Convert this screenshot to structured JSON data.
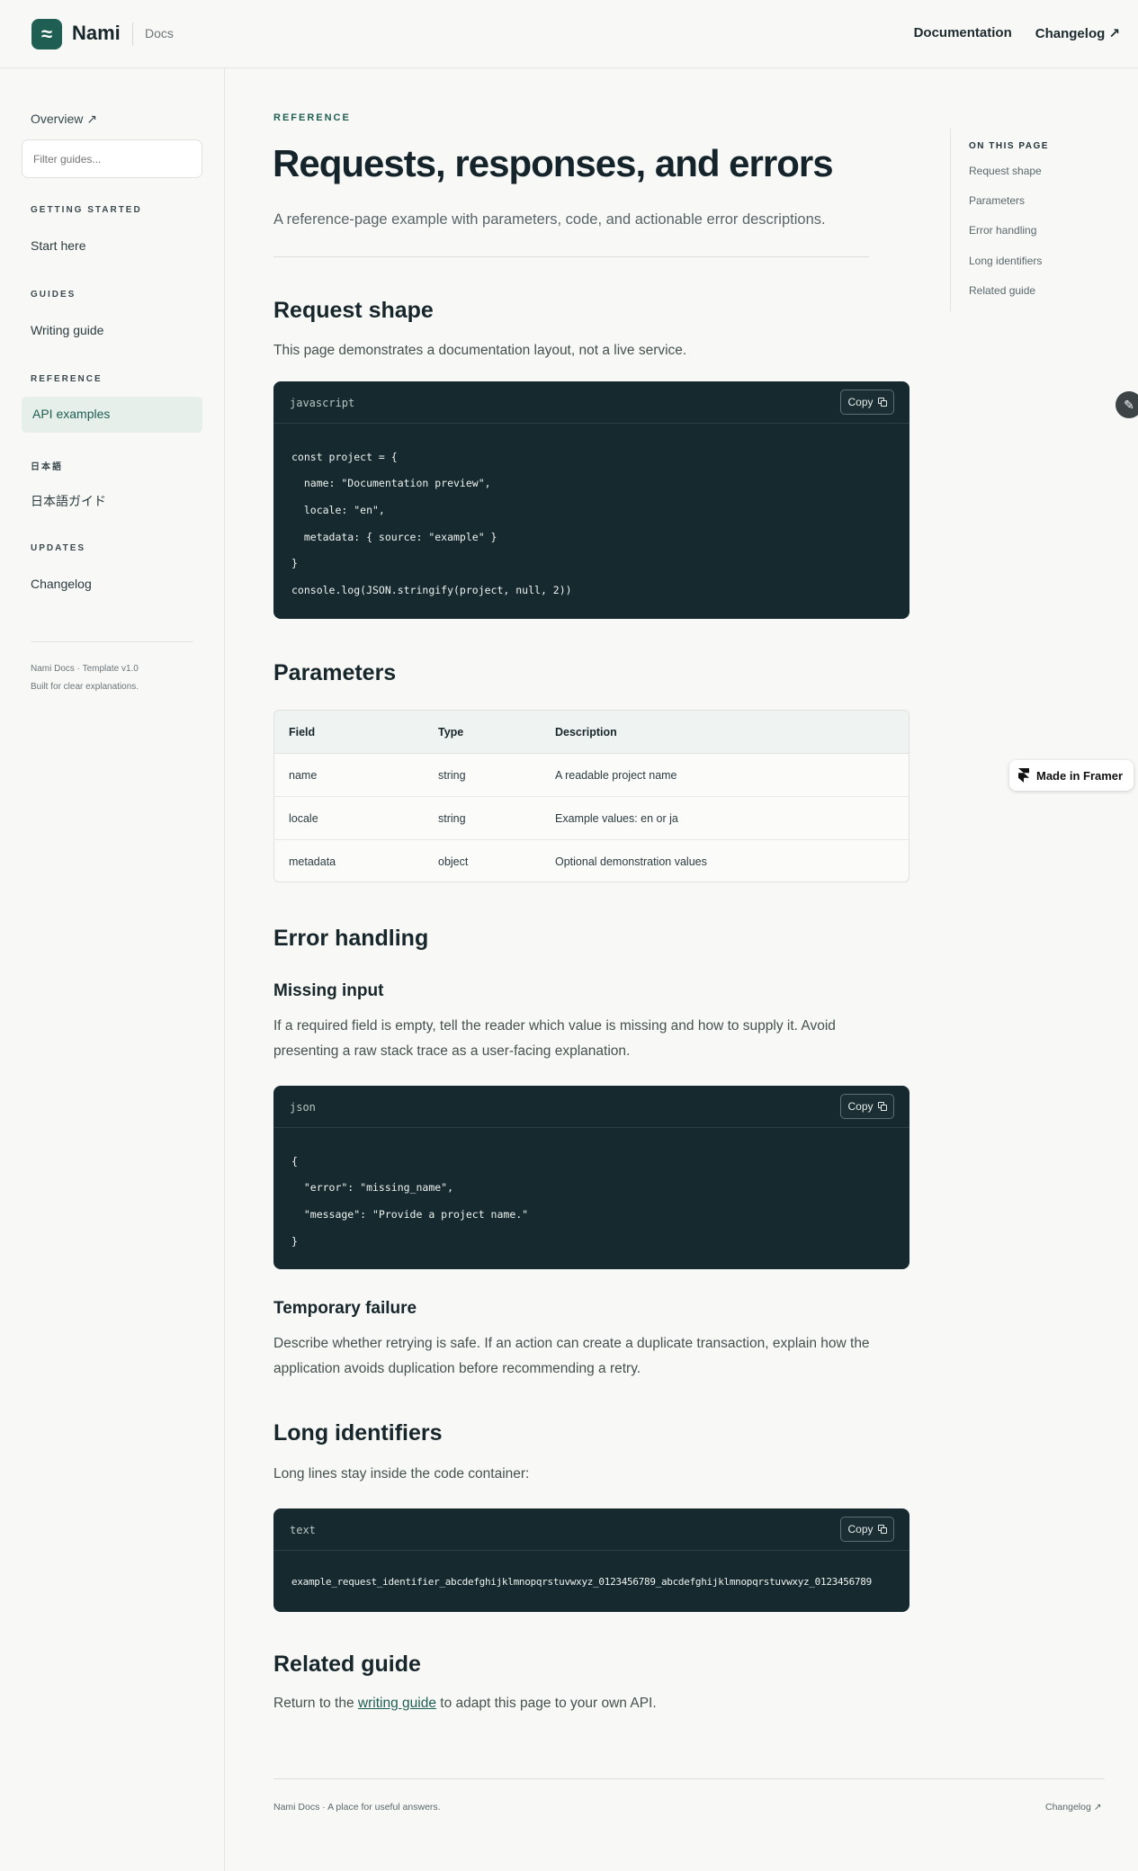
{
  "header": {
    "brand": "Nami",
    "brand_sub": "Docs",
    "nav": [
      "Documentation",
      "Changelog ↗"
    ]
  },
  "sidebar": {
    "overview": "Overview ↗",
    "filter_placeholder": "Filter guides...",
    "sections": [
      {
        "heading": "GETTING STARTED",
        "items": [
          "Start here"
        ]
      },
      {
        "heading": "GUIDES",
        "items": [
          "Writing guide"
        ]
      },
      {
        "heading": "REFERENCE",
        "items": [
          "API examples"
        ]
      },
      {
        "heading": "日本語",
        "items": [
          "日本語ガイド"
        ]
      },
      {
        "heading": "UPDATES",
        "items": [
          "Changelog"
        ]
      }
    ],
    "active_item": "API examples",
    "footer": [
      "Nami Docs · Template v1.0",
      "Built for clear explanations."
    ]
  },
  "main": {
    "eyebrow": "REFERENCE",
    "title": "Requests, responses, and errors",
    "lead": "A reference-page example with parameters, code, and actionable error descriptions.",
    "request_shape": {
      "heading": "Request shape",
      "text": "This page demonstrates a documentation layout, not a live service.",
      "code": {
        "lang": "javascript",
        "copy": "Copy",
        "lines": [
          "const project = {",
          "  name: \"Documentation preview\",",
          "  locale: \"en\",",
          "  metadata: { source: \"example\" }",
          "}",
          "console.log(JSON.stringify(project, null, 2))"
        ]
      }
    },
    "parameters": {
      "heading": "Parameters",
      "columns": [
        "Field",
        "Type",
        "Description"
      ],
      "rows": [
        [
          "name",
          "string",
          "A readable project name"
        ],
        [
          "locale",
          "string",
          "Example values: en or ja"
        ],
        [
          "metadata",
          "object",
          "Optional demonstration values"
        ]
      ]
    },
    "error_handling": {
      "heading": "Error handling",
      "missing_input": {
        "heading": "Missing input",
        "text": "If a required field is empty, tell the reader which value is missing and how to supply it. Avoid presenting a raw stack trace as a user-facing explanation.",
        "code": {
          "lang": "json",
          "copy": "Copy",
          "lines": [
            "{",
            "  \"error\": \"missing_name\",",
            "  \"message\": \"Provide a project name.\"",
            "}"
          ]
        }
      },
      "temporary_failure": {
        "heading": "Temporary failure",
        "text": "Describe whether retrying is safe. If an action can create a duplicate transaction, explain how the application avoids duplication before recommending a retry."
      }
    },
    "long_identifiers": {
      "heading": "Long identifiers",
      "text": "Long lines stay inside the code container:",
      "code": {
        "lang": "text",
        "copy": "Copy",
        "lines": [
          "example_request_identifier_abcdefghijklmnopqrstuvwxyz_0123456789_abcdefghijklmnopqrstuvwxyz_0123456789"
        ]
      }
    },
    "related_guide": {
      "heading": "Related guide",
      "before": "Return to the ",
      "link": "writing guide",
      "after": " to adapt this page to your own API."
    }
  },
  "toc": {
    "heading": "ON THIS PAGE",
    "items": [
      "Request shape",
      "Parameters",
      "Error handling",
      "Long identifiers",
      "Related guide"
    ]
  },
  "framer_badge": "Made in Framer",
  "footer": {
    "left": "Nami Docs · A place for useful answers.",
    "right": "Changelog ↗"
  },
  "icons": {
    "logo": "waves-icon",
    "copy": "copy-icon",
    "edit": "pencil-icon",
    "framer": "framer-logo-icon"
  },
  "colors": {
    "accent": "#1f5e52",
    "code_bg": "#16292e",
    "active_bg": "#e6efea",
    "page_bg": "#f8f8f6"
  }
}
